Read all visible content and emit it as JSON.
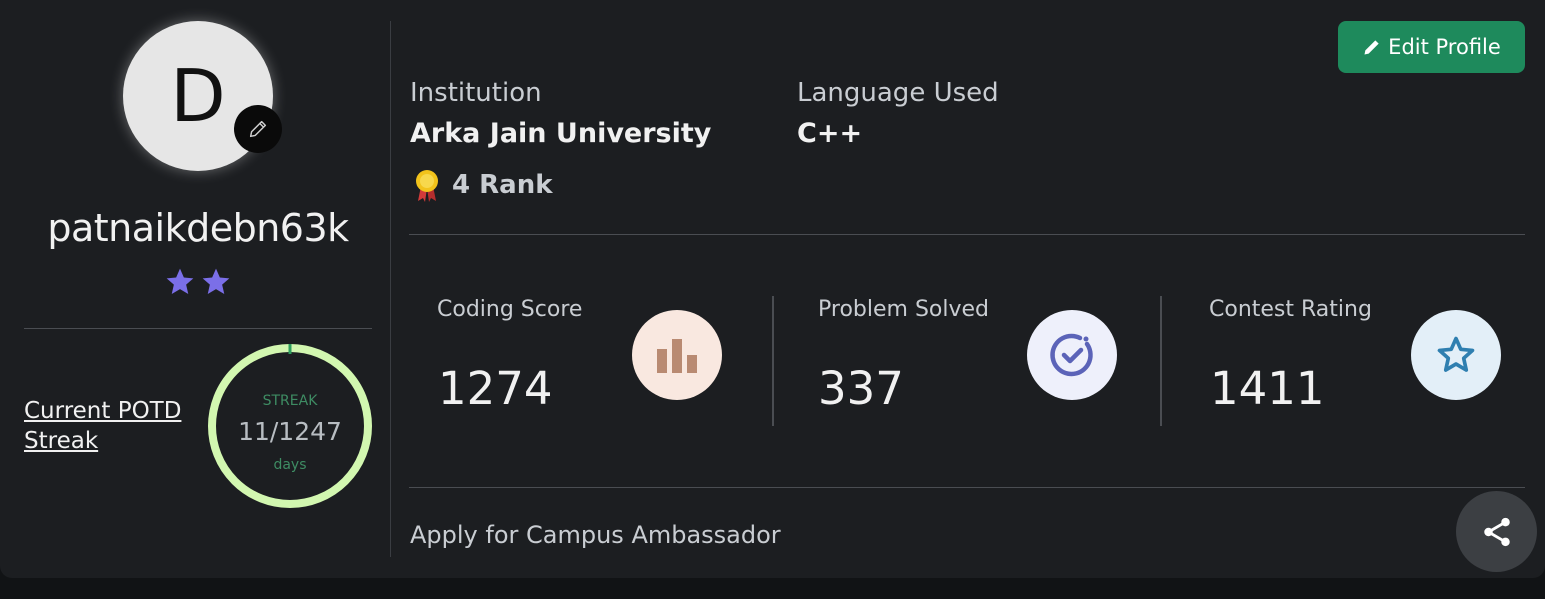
{
  "profile": {
    "avatar_initial": "D",
    "username": "patnaikdebn63k",
    "star_count": 2,
    "star_color": "#7b6fe8"
  },
  "streak": {
    "link_text": "Current POTD Streak",
    "label": "STREAK",
    "count": "11/1247",
    "unit": "days",
    "ring_color": "#d2f7b0",
    "progress": 0.0088
  },
  "header": {
    "edit_profile_label": "Edit Profile"
  },
  "info": {
    "institution_label": "Institution",
    "institution_value": "Arka Jain University",
    "language_label": "Language Used",
    "language_value": "C++",
    "rank_text": "4 Rank"
  },
  "stats": [
    {
      "label": "Coding Score",
      "value": "1274",
      "icon": "bar-chart-icon",
      "icon_bg": "#f9e8e0"
    },
    {
      "label": "Problem Solved",
      "value": "337",
      "icon": "check-circle-icon",
      "icon_bg": "#eef0fb"
    },
    {
      "label": "Contest Rating",
      "value": "1411",
      "icon": "star-icon",
      "icon_bg": "#e3eff8"
    }
  ],
  "footer": {
    "apply_text": "Apply for Campus Ambassador"
  },
  "colors": {
    "accent_green": "#1e8a5c"
  }
}
